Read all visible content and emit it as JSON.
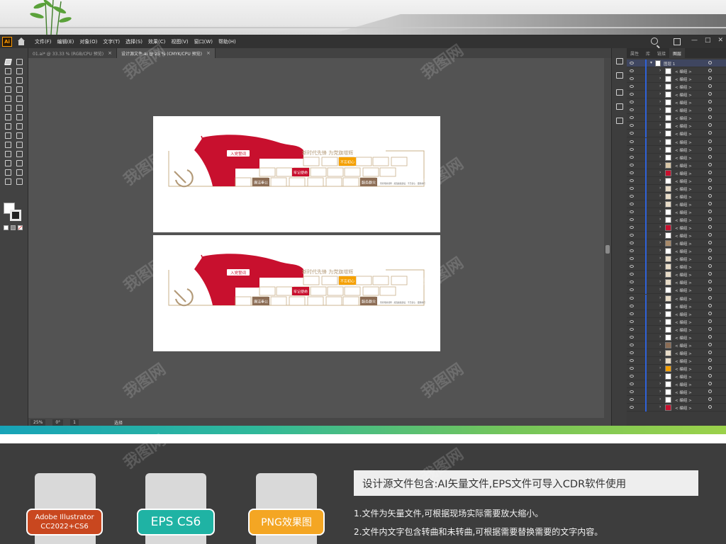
{
  "menubar": {
    "app_logo": "Ai",
    "items": [
      "文件(F)",
      "编辑(E)",
      "对象(O)",
      "文字(T)",
      "选择(S)",
      "效果(C)",
      "视图(V)",
      "窗口(W)",
      "帮助(H)"
    ]
  },
  "tabs": [
    {
      "label": "01.ai* @ 33.33 % (RGB/CPU 预览)",
      "close": "×"
    },
    {
      "label": "设计源文件.ai @ 25 % (CMYK/CPU 预览)",
      "close": "×"
    }
  ],
  "window_controls": {
    "minimize": "—",
    "maximize": "□",
    "close": "✕"
  },
  "status": {
    "zoom": "25%",
    "rotation": "0°",
    "artboard": "1",
    "tool": "选择"
  },
  "layers_panel": {
    "tabs": [
      "属性",
      "库",
      "链接",
      "图层"
    ],
    "active_tab": "图层",
    "top_layer": "图层 1",
    "sublayer_label": "< 编组 >",
    "accent_color": "#2f62d9"
  },
  "artwork": {
    "tab_label": "入党誓词",
    "slogan": "新时代先锋  为党旗增辉",
    "tags": [
      "不忘初心",
      "牢记使命",
      "廉洁奉公",
      "服务群众"
    ],
    "footer_text": "坚持党的领导 · 加强廉政建设 · 不忘初心 · 砥砺前行",
    "brand_red": "#c8102e",
    "brand_orange": "#f5a000",
    "brand_brown": "#8c6d55"
  },
  "info": {
    "formats": [
      {
        "line1": "Adobe Illustrator",
        "line2": "CC2022+CS6",
        "color": "#c9471f"
      },
      {
        "line1": "EPS CS6",
        "line2": "",
        "color": "#1fb3a4"
      },
      {
        "line1": "PNG效果图",
        "line2": "",
        "color": "#f4a623"
      }
    ],
    "title": "设计源文件包含:AI矢量文件,EPS文件可导入CDR软件使用",
    "notes": [
      "1.文件为矢量文件,可根据现场实际需要放大缩小。",
      "2.文件内文字包含转曲和未转曲,可根据需要替换需要的文字内容。"
    ]
  },
  "watermark": "我图网"
}
